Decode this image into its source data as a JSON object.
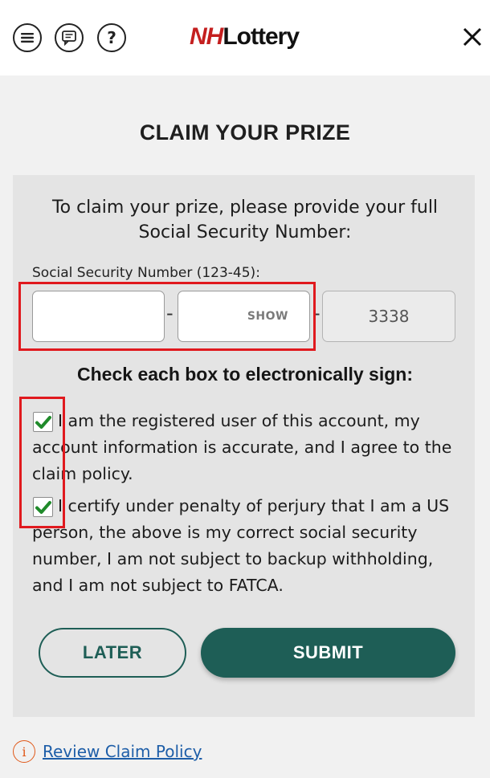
{
  "header": {
    "logo_prefix": "NH",
    "logo_suffix": "Lottery",
    "icons": [
      "menu-icon",
      "chat-icon",
      "help-icon",
      "close-icon"
    ]
  },
  "page": {
    "title": "CLAIM YOUR PRIZE",
    "intro_line1": "To claim your prize, please provide your full",
    "intro_line2": "Social Security Number:"
  },
  "ssn": {
    "label": "Social Security Number (123-45):",
    "part1_value": "",
    "part2_value": "",
    "show_label": "SHOW",
    "dash": "-",
    "last4": "3338"
  },
  "sign": {
    "heading": "Check each box to electronically sign:",
    "items": [
      {
        "checked": true,
        "text": "I am the registered user of this account, my account information is accurate, and I agree to the claim policy."
      },
      {
        "checked": true,
        "text": "I certify under penalty of perjury that I am a US person, the above is my correct social security number, I am not subject to backup withholding, and I am not subject to FATCA."
      }
    ]
  },
  "buttons": {
    "later": "LATER",
    "submit": "SUBMIT"
  },
  "footer": {
    "info_symbol": "i",
    "link": "Review Claim Policy"
  },
  "colors": {
    "accent": "#1e5e56",
    "highlight": "#e0191e",
    "check": "#1f8a2a",
    "link": "#1e5ea8"
  }
}
